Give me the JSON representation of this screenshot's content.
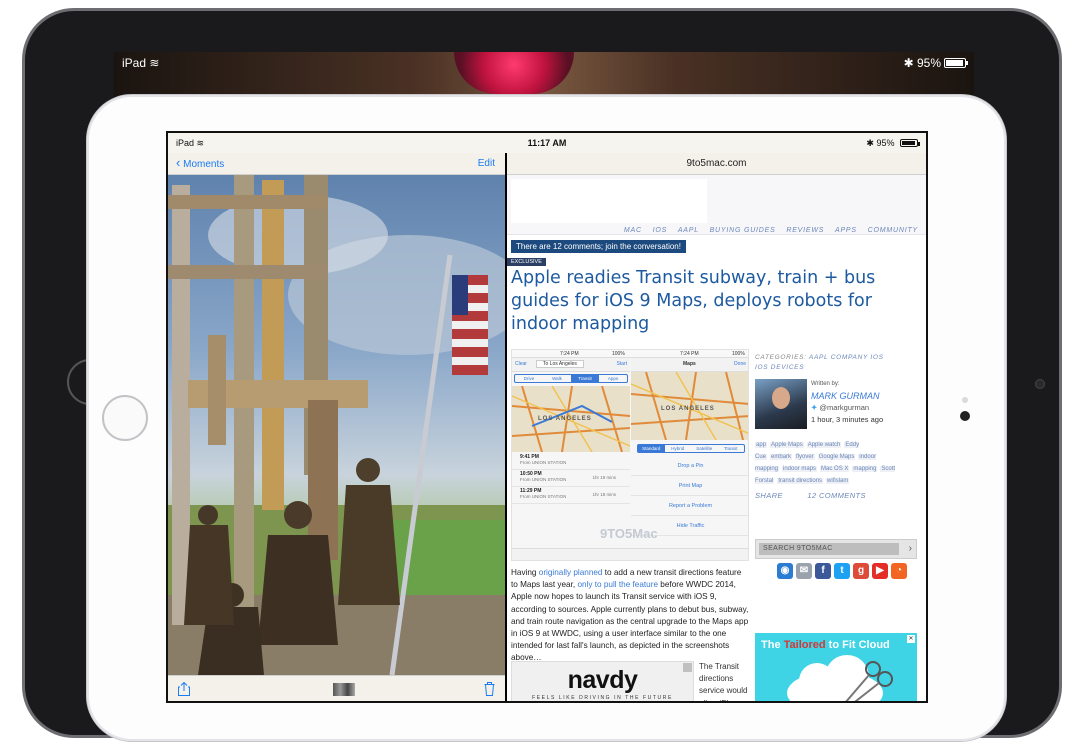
{
  "back_device": {
    "status": {
      "carrier": "iPad",
      "battery": "95%"
    }
  },
  "screen": {
    "status": {
      "carrier": "iPad",
      "time": "11:17 AM",
      "battery": "95%"
    },
    "photos": {
      "back_label": "Moments",
      "edit_label": "Edit"
    },
    "safari": {
      "url": "9to5mac.com",
      "nav": [
        "MAC",
        "IOS",
        "AAPL",
        "BUYING GUIDES",
        "REVIEWS",
        "APPS",
        "COMMUNITY"
      ],
      "comments_banner": "There are 12 comments; join the conversation!",
      "exclusive": "EXCLUSIVE",
      "headline": "Apple readies Transit subway, train + bus guides for iOS 9 Maps, deploys robots for indoor mapping",
      "screenshot": {
        "time": "7:24 PM",
        "time2": "7:24 PM",
        "battery": "100%",
        "battery2": "100%",
        "clear": "Clear",
        "destination": "To Los Angeles",
        "start": "Start",
        "maps_title": "Maps",
        "done": "Done",
        "tabs": [
          "Drive",
          "Walk",
          "Transit",
          "Apps"
        ],
        "map_label": "LOS ANGELES",
        "map_label2": "LOS ANGELES",
        "segments": [
          "Standard",
          "Hybrid",
          "Satellite",
          "Transit"
        ],
        "routes": [
          {
            "time": "9:41 PM",
            "from": "From UNION STATION",
            "duration": ""
          },
          {
            "time": "10:50 PM",
            "from": "From UNION STATION",
            "duration": "1hr 19 mins"
          },
          {
            "time": "11:29 PM",
            "from": "From UNION STATION",
            "duration": "1hr 18 mins"
          }
        ],
        "menu": [
          "Drop a Pin",
          "Print Map",
          "Report a Problem",
          "Hide Traffic"
        ],
        "watermark": "9TO5Mac"
      },
      "body": {
        "p1": "Having ",
        "link1": "originally planned",
        "p2": " to add a new transit directions feature to Maps last year, ",
        "link2": "only to pull the feature",
        "p3": " before WWDC 2014, Apple now hopes to launch its Transit service with iOS 9, according to sources. Apple currently plans to debut bus, subway, and train route navigation as the central upgrade to the Maps app in iOS 9 at WWDC, using a user interface similar to the one intended for last fall's launch, as depicted in the screenshots above…"
      },
      "ad_navdy": {
        "brand": "navdy",
        "tagline": "FEELS LIKE DRIVING IN THE FUTURE"
      },
      "side_text": "The Transit directions service would allow iPhone",
      "sidebar": {
        "categories_label": "CATEGORIES:",
        "categories": [
          "AAPL COMPANY",
          "IOS",
          "IOS DEVICES"
        ],
        "written_by": "Written by:",
        "author": "MARK GURMAN",
        "twitter": "@markgurman",
        "time_ago": "1 hour, 3 minutes ago",
        "tags": [
          "app",
          "Apple Maps",
          "Apple watch",
          "Eddy Cue",
          "embark",
          "flyover",
          "Google Maps",
          "indoor mapping",
          "indoor maps",
          "Mac OS X",
          "mapping",
          "Scott Forstal",
          "transit directions",
          "wifislam"
        ],
        "share": "SHARE",
        "comments": "12 COMMENTS",
        "search_placeholder": "SEARCH 9TO5MAC",
        "ad_headline_1": "The ",
        "ad_headline_2": "Tailored",
        "ad_headline_3": " to Fit Cloud"
      }
    }
  },
  "colors": {
    "link_blue": "#3a7ad6",
    "headline_blue": "#1d5aa0",
    "banner_navy": "#1d4a7e",
    "ios_blue": "#1a7cf5"
  }
}
